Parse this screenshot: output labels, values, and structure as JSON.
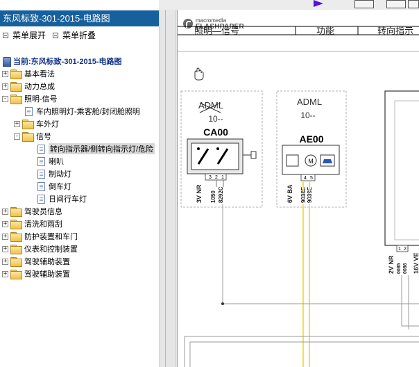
{
  "tree_panel": {
    "title": "东风标致-301-2015-电路图",
    "expand_all": "菜单展开",
    "collapse_all": "菜单折叠",
    "current": "当前:东风标致-301-2015-电路图",
    "items": [
      {
        "label": "基本看法",
        "type": "folder",
        "toggle": "+"
      },
      {
        "label": "动力总成",
        "type": "folder",
        "toggle": "+"
      },
      {
        "label": "照明-信号",
        "type": "folder",
        "toggle": "-"
      },
      {
        "label": "车内照明灯-乘客舱/封闭舱照明",
        "type": "page"
      },
      {
        "label": "车外灯",
        "type": "folder",
        "toggle": "+"
      },
      {
        "label": "信号",
        "type": "folder",
        "toggle": "-"
      },
      {
        "label": "转向指示器/侧转向指示灯/危险",
        "type": "page",
        "selected": true
      },
      {
        "label": "喇叭",
        "type": "page"
      },
      {
        "label": "制动灯",
        "type": "page"
      },
      {
        "label": "倒车灯",
        "type": "page"
      },
      {
        "label": "日间行车灯",
        "type": "page"
      },
      {
        "label": "驾驶员信息",
        "type": "folder",
        "toggle": "+"
      },
      {
        "label": "清洗和雨刮",
        "type": "folder",
        "toggle": "+"
      },
      {
        "label": "防护装置和车门",
        "type": "folder",
        "toggle": "+"
      },
      {
        "label": "仪表和控制装置",
        "type": "folder",
        "toggle": "+"
      },
      {
        "label": "驾驶辅助装置",
        "type": "folder",
        "toggle": "+"
      },
      {
        "label": "驾驶辅助装置",
        "type": "folder",
        "toggle": "+"
      }
    ]
  },
  "viewer": {
    "brand_line1": "macromedia",
    "brand_line2": "FLASHPAPER",
    "header_cells": [
      "照明—信号",
      "功能",
      "转向指示"
    ],
    "icons": {
      "hand": "hand-pan-icon"
    }
  },
  "diagram": {
    "box1": {
      "label_struck": "ADML",
      "sub": "10--",
      "code": "CA00",
      "pins": [
        "3",
        "2",
        "1"
      ],
      "wires": [
        "3V NR",
        "1050",
        "8292C"
      ]
    },
    "box2": {
      "label": "ADML",
      "sub": "10--",
      "code": "AE00",
      "pins": [
        "4",
        "5"
      ],
      "wires": [
        "6V BA",
        "9038E",
        "9039E"
      ]
    },
    "box3": {
      "pins": [
        "1",
        "2"
      ],
      "wires": [
        "2V NR",
        "0085",
        "0086",
        "16V VE"
      ]
    }
  }
}
